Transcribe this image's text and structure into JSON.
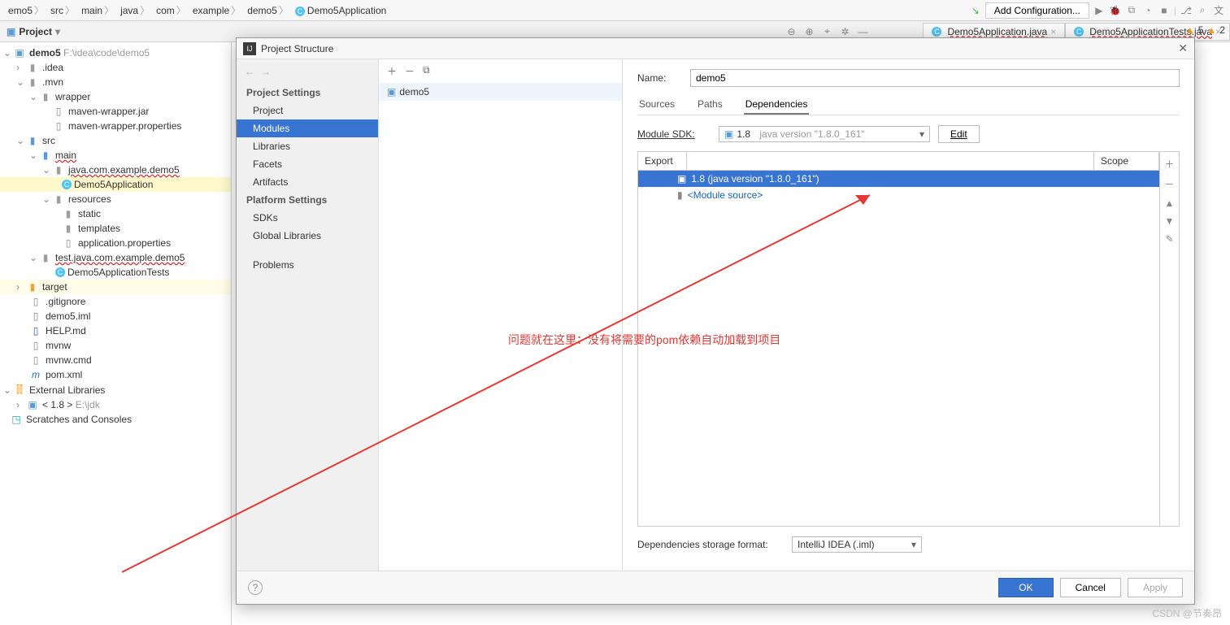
{
  "breadcrumb": [
    "emo5",
    "src",
    "main",
    "java",
    "com",
    "example",
    "demo5",
    "Demo5Application"
  ],
  "topbar": {
    "add_config": "Add Configuration..."
  },
  "project_tw": "Project",
  "editor_tabs": [
    {
      "label": "Demo5Application.java"
    },
    {
      "label": "Demo5ApplicationTests.java"
    }
  ],
  "tree": {
    "root": {
      "name": "demo5",
      "path": "F:\\idea\\code\\demo5"
    },
    "idea": ".idea",
    "mvn": ".mvn",
    "wrapper": "wrapper",
    "mw_jar": "maven-wrapper.jar",
    "mw_prop": "maven-wrapper.properties",
    "src": "src",
    "main": "main",
    "pkg": "java.com.example.demo5",
    "app_class": "Demo5Application",
    "resources": "resources",
    "static": "static",
    "templates": "templates",
    "app_prop": "application.properties",
    "test_pkg": "test.java.com.example.demo5",
    "tests_class": "Demo5ApplicationTests",
    "target": "target",
    "gitignore": ".gitignore",
    "iml": "demo5.iml",
    "help": "HELP.md",
    "mvnw": "mvnw",
    "mvnw_cmd": "mvnw.cmd",
    "pom": "pom.xml",
    "ext_lib": "External Libraries",
    "jdk_name": "< 1.8 >",
    "jdk_path": "E:\\jdk",
    "scratches": "Scratches and Consoles"
  },
  "dialog": {
    "title": "Project Structure",
    "sidebar": {
      "settings": "Project Settings",
      "project": "Project",
      "modules": "Modules",
      "libraries": "Libraries",
      "facets": "Facets",
      "artifacts": "Artifacts",
      "platform": "Platform Settings",
      "sdks": "SDKs",
      "global": "Global Libraries",
      "problems": "Problems"
    },
    "mid_item": "demo5",
    "name_label": "Name:",
    "name_value": "demo5",
    "tabs": {
      "sources": "Sources",
      "paths": "Paths",
      "deps": "Dependencies"
    },
    "sdk_label": "Module SDK:",
    "sdk_value": "1.8",
    "sdk_sub": "java version \"1.8.0_161\"",
    "edit": "Edit",
    "export": "Export",
    "scope": "Scope",
    "dep1": "1.8 (java version \"1.8.0_161\")",
    "dep2": "<Module source>",
    "storage": "Dependencies storage format:",
    "storage_val": "IntelliJ IDEA (.iml)",
    "ok": "OK",
    "cancel": "Cancel",
    "apply": "Apply"
  },
  "annotation": "问题就在这里：没有将需要的pom依赖自动加载到项目",
  "status": {
    "warn": "5",
    "warn2": "2"
  },
  "watermark": "CSDN @节奏昂"
}
